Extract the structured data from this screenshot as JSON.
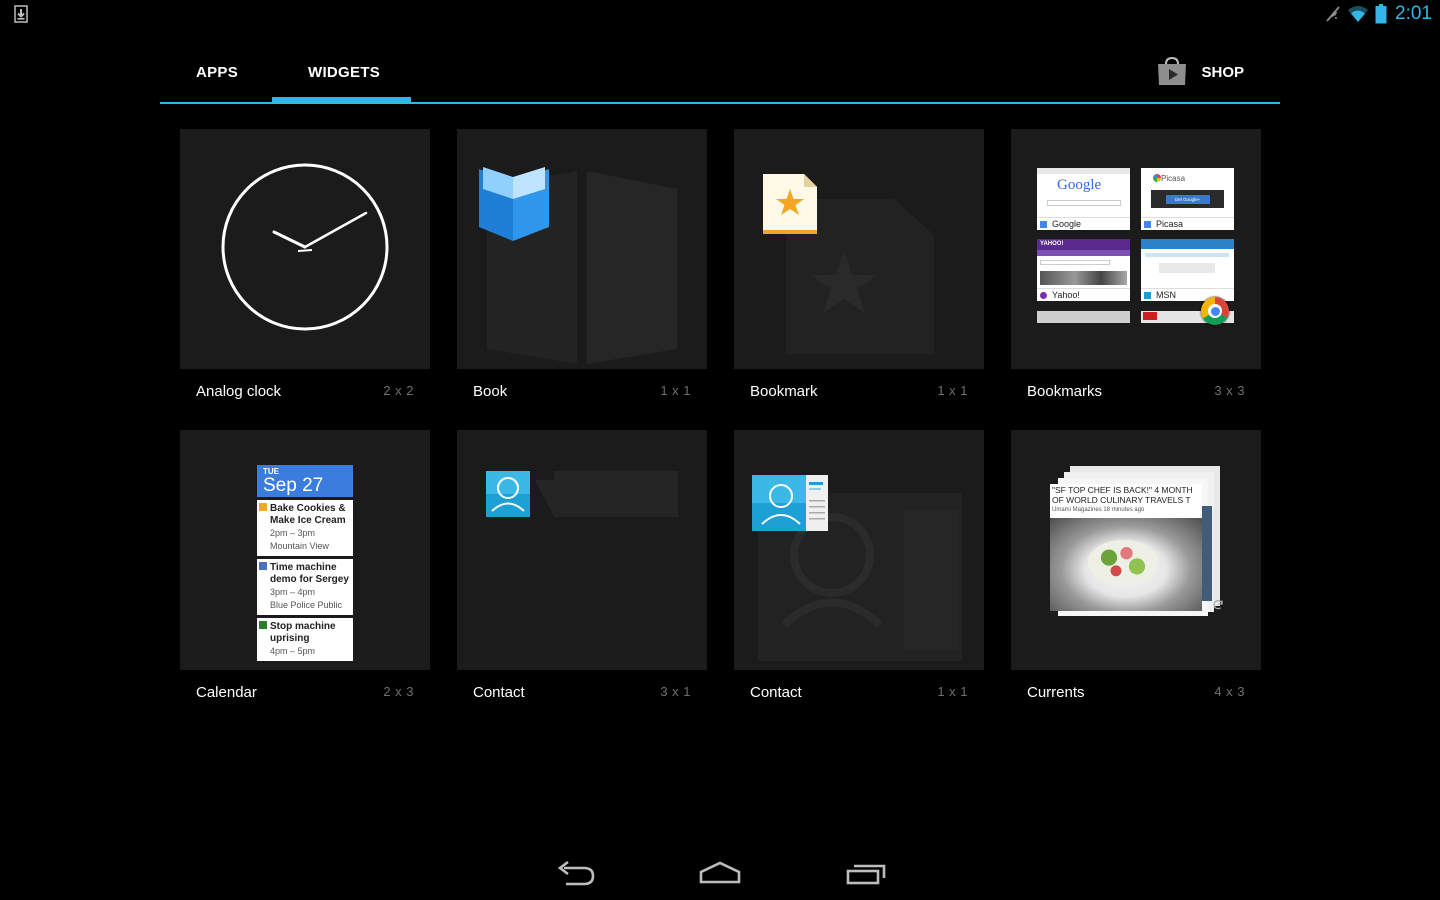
{
  "status_bar": {
    "download_icon": "download-icon",
    "icons": [
      "mute-icon",
      "wifi-icon",
      "battery-icon"
    ],
    "time": "2:01",
    "accent": "#33b5e5"
  },
  "tabs": {
    "apps_label": "APPS",
    "widgets_label": "WIDGETS",
    "active": "WIDGETS",
    "shop_label": "SHOP",
    "shop_icon": "shop-bag-icon"
  },
  "widgets": [
    {
      "name": "Analog clock",
      "size": "2 x 2",
      "icon": "analog-clock-icon"
    },
    {
      "name": "Book",
      "size": "1 x 1",
      "icon": "book-icon"
    },
    {
      "name": "Bookmark",
      "size": "1 x 1",
      "icon": "bookmark-icon"
    },
    {
      "name": "Bookmarks",
      "size": "3 x 3",
      "icon": "bookmarks-grid-icon"
    },
    {
      "name": "Calendar",
      "size": "2 x 3",
      "icon": "calendar-icon"
    },
    {
      "name": "Contact",
      "size": "3 x 1",
      "icon": "contact-icon"
    },
    {
      "name": "Contact",
      "size": "1 x 1",
      "icon": "contact-card-icon"
    },
    {
      "name": "Currents",
      "size": "4 x 3",
      "icon": "currents-icon"
    }
  ],
  "bookmarks_preview": {
    "sites": [
      "Google",
      "Picasa",
      "Yahoo!",
      "MSN"
    ],
    "google_logo": "Google",
    "picasa_logo": "Picasa",
    "picasa_button": "Get Google+",
    "yahoo_logo": "YAHOO!"
  },
  "calendar_preview": {
    "day": "TUE",
    "date": "Sep 27",
    "events": [
      {
        "title": "Bake Cookies & Make Ice Cream",
        "time": "2pm – 3pm",
        "place": "Mountain View",
        "color": "#f2a62b"
      },
      {
        "title": "Time machine demo for Sergey",
        "time": "3pm – 4pm",
        "place": "Blue Police Public",
        "color": "#4c6fc0"
      },
      {
        "title": "Stop machine uprising",
        "time": "4pm – 5pm",
        "place": "",
        "color": "#2e7d2e"
      }
    ]
  },
  "currents_preview": {
    "headline": "\"SF TOP CHEF IS BACK!\" 4 MONTH OF WORLD CULINARY TRAVELS T",
    "meta": "Umami Magazines 18 minutes ago"
  },
  "nav_bar": {
    "back_icon": "back-icon",
    "home_icon": "home-icon",
    "recents_icon": "recent-apps-icon"
  }
}
